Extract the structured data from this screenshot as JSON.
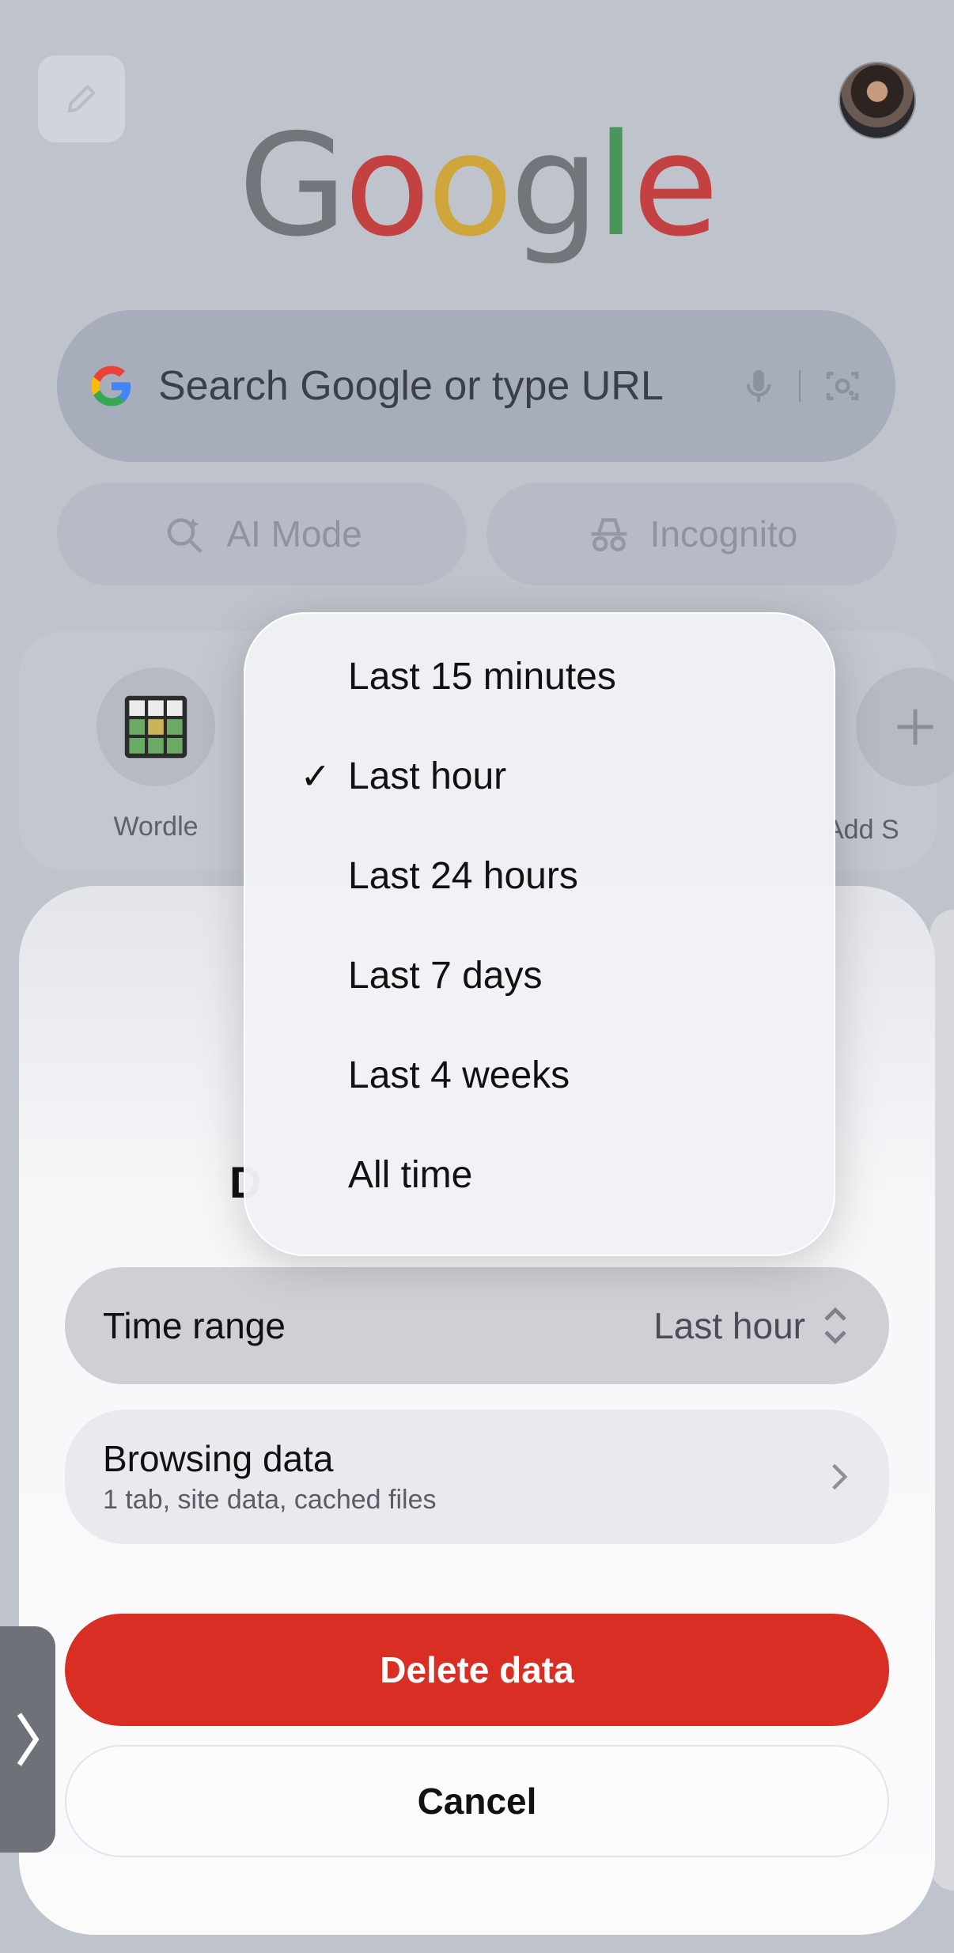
{
  "colors": {
    "background": "#bfc3cc",
    "delete_button": "#d82e24",
    "google_blue": "#4285F4",
    "google_red": "#EA4335",
    "google_yellow": "#FBBC05",
    "google_green": "#34A853"
  },
  "header": {
    "edit_icon": "pencil-icon",
    "logo_letters": [
      "G",
      "o",
      "o",
      "g",
      "l",
      "e"
    ]
  },
  "search": {
    "placeholder": "Search Google or type URL",
    "mic_icon": "microphone-icon",
    "lens_icon": "camera-lens-icon"
  },
  "mode_buttons": {
    "ai_mode": "AI Mode",
    "incognito": "Incognito"
  },
  "shortcuts": {
    "items": [
      {
        "label": "Wordle",
        "icon": "wordle-grid-icon"
      },
      {
        "label": "Add S",
        "icon": "plus-icon"
      }
    ]
  },
  "sheet": {
    "title_fragment": "D",
    "time_range_label": "Time range",
    "time_range_value": "Last hour",
    "browsing_data_title": "Browsing data",
    "browsing_data_subtitle": "1 tab, site data, cached files",
    "delete_label": "Delete data",
    "cancel_label": "Cancel"
  },
  "menu": {
    "selected_index": 1,
    "items": [
      {
        "label": "Last 15 minutes"
      },
      {
        "label": "Last hour"
      },
      {
        "label": "Last 24 hours"
      },
      {
        "label": "Last 7 days"
      },
      {
        "label": "Last 4 weeks"
      },
      {
        "label": "All time"
      }
    ]
  },
  "side_handle": {
    "icon": "chevron-right-icon"
  }
}
